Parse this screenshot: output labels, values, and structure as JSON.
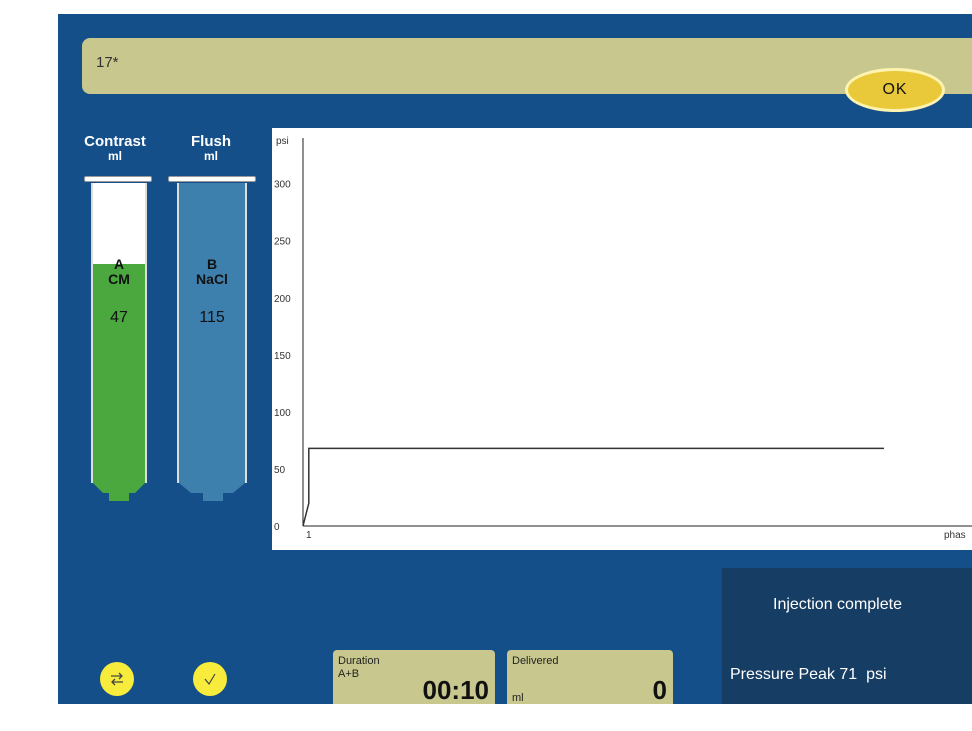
{
  "header": {
    "value": "17*",
    "ok_label": "OK"
  },
  "syringes": {
    "contrast": {
      "title": "Contrast",
      "unit": "ml",
      "letter": "A",
      "type": "CM",
      "volume": "47",
      "fill_fraction": 0.73,
      "color": "#4aa83f"
    },
    "flush": {
      "title": "Flush",
      "unit": "ml",
      "letter": "B",
      "type": "NaCl",
      "volume": "115",
      "fill_fraction": 1.0,
      "color": "#3d7fad"
    }
  },
  "chart_data": {
    "type": "line",
    "ylabel": "psi",
    "xlabel": "phas",
    "yticks": [
      0,
      50,
      100,
      150,
      200,
      250,
      300
    ],
    "ylim": [
      0,
      340
    ],
    "xtick": "1",
    "series": [
      {
        "x": [
          0,
          0,
          0.01,
          0.01,
          1
        ],
        "y": [
          0,
          0,
          20,
          68,
          68
        ]
      }
    ]
  },
  "chart_labels": {
    "psi": "psi",
    "phase": "phas",
    "x1": "1"
  },
  "bottom": {
    "duration": {
      "label": "Duration",
      "sub": "A+B",
      "value": "00:10"
    },
    "delivered": {
      "label": "Delivered",
      "unit": "ml",
      "value": "0"
    }
  },
  "status": {
    "message": "Injection complete",
    "peak": "Pressure Peak 71  psi"
  },
  "icons": {
    "swap": "swap-icon",
    "check": "check-icon"
  },
  "colors": {
    "screen_bg": "#154f8a",
    "panel": "#c8c88e",
    "ok": "#e9c93a",
    "status_bg": "#163d63"
  }
}
